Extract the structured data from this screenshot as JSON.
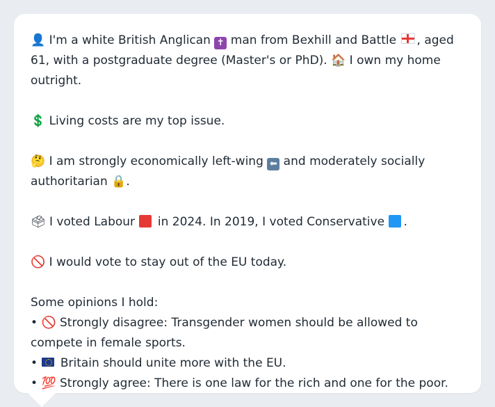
{
  "profile": {
    "line1_icon": "👤",
    "line1_a": " I'm a white British Anglican ",
    "religion_icon": "✝",
    "line1_b": " man from Bexhill and Battle ",
    "line1_c": ", aged 61, with a postgraduate degree (Master's or PhD). ",
    "home_icon": "🏠",
    "line1_d": " I own my home outright."
  },
  "issue": {
    "icon": "💲",
    "text": " Living costs are my top issue."
  },
  "ideology": {
    "icon": "🤔",
    "text_a": " I am strongly economically left-wing ",
    "left_icon": "⬅",
    "text_b": " and moderately socially authoritarian ",
    "lock_icon": "🔒",
    "text_c": "."
  },
  "votes": {
    "icon": "🗳",
    "text_a": " I voted Labour ",
    "text_b": " in 2024. In 2019, I voted Conservative ",
    "text_c": "."
  },
  "eu": {
    "icon": "🚫",
    "text": " I would vote to stay out of the EU today."
  },
  "opinions": {
    "heading": "Some opinions I hold:",
    "items": [
      {
        "bullet": "• ",
        "icon": "🚫",
        "text": " Strongly disagree: Transgender women should be allowed to compete in female sports."
      },
      {
        "bullet": "• ",
        "icon": "eu-flag",
        "text": " Britain should unite more with the EU."
      },
      {
        "bullet": "• ",
        "icon": "💯",
        "text": " Strongly agree: There is one law for the rich and one for the poor."
      }
    ]
  },
  "colors": {
    "labour": "#e53935",
    "conservative": "#2196f3",
    "background": "#e9ecf0",
    "card": "#ffffff"
  }
}
